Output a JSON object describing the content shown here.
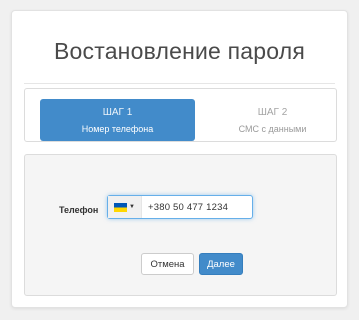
{
  "page": {
    "title": "Востановление пароля"
  },
  "steps": [
    {
      "number": "ШАГ 1",
      "label": "Номер телефона",
      "active": true
    },
    {
      "number": "ШАГ 2",
      "label": "СМС с данными",
      "active": false
    }
  ],
  "form": {
    "phone_label": "Телефон",
    "phone_value": "+380 50 477 1234",
    "country_flag": "ukraine-flag",
    "cancel_label": "Отмена",
    "next_label": "Далее"
  },
  "colors": {
    "primary": "#428bca",
    "flag_blue": "#0057b7",
    "flag_yellow": "#ffd700"
  }
}
